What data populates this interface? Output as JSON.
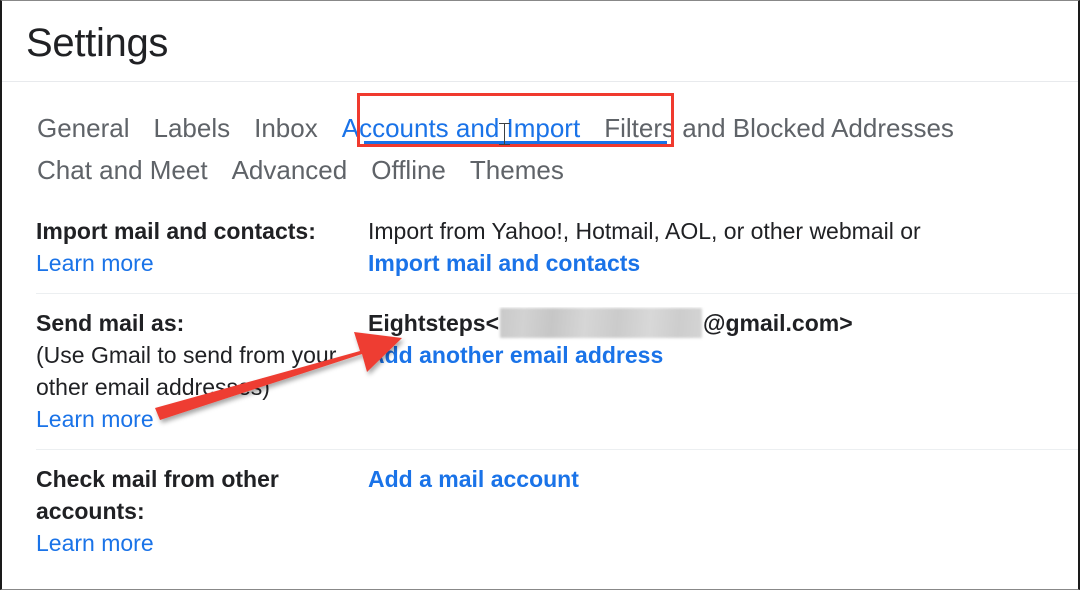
{
  "page": {
    "title": "Settings"
  },
  "tabs": {
    "row1": [
      {
        "label": "General",
        "active": false
      },
      {
        "label": "Labels",
        "active": false
      },
      {
        "label": "Inbox",
        "active": false
      },
      {
        "label": "Accounts and Import",
        "active": true
      },
      {
        "label": "Filters and Blocked Addresses",
        "active": false
      }
    ],
    "row2": [
      {
        "label": "Chat and Meet",
        "active": false
      },
      {
        "label": "Advanced",
        "active": false
      },
      {
        "label": "Offline",
        "active": false
      },
      {
        "label": "Themes",
        "active": false
      }
    ]
  },
  "settings_rows": [
    {
      "label": "Import mail and contacts:",
      "note": "",
      "learn_more": "Learn more",
      "description": "Import from Yahoo!, Hotmail, AOL, or other webmail or",
      "action": "Import mail and contacts"
    },
    {
      "label": "Send mail as:",
      "note": "(Use Gmail to send from your other email addresses)",
      "learn_more": "Learn more",
      "account_name": "Eightsteps",
      "account_open": "<",
      "account_domain": "@gmail.com>",
      "action": "Add another email address"
    },
    {
      "label": "Check mail from other accounts:",
      "note": "",
      "learn_more": "Learn more",
      "action": "Add a mail account"
    }
  ],
  "annotations": {
    "highlight_box_color": "#f03a2e",
    "arrow_color": "#ee3e33",
    "arrow_from": "(152, 406)",
    "arrow_to": "(398, 338)"
  },
  "colors": {
    "link_blue": "#1a73e8",
    "text_dark": "#202124",
    "tab_grey": "#5f6368",
    "divider": "#e8eaed"
  }
}
